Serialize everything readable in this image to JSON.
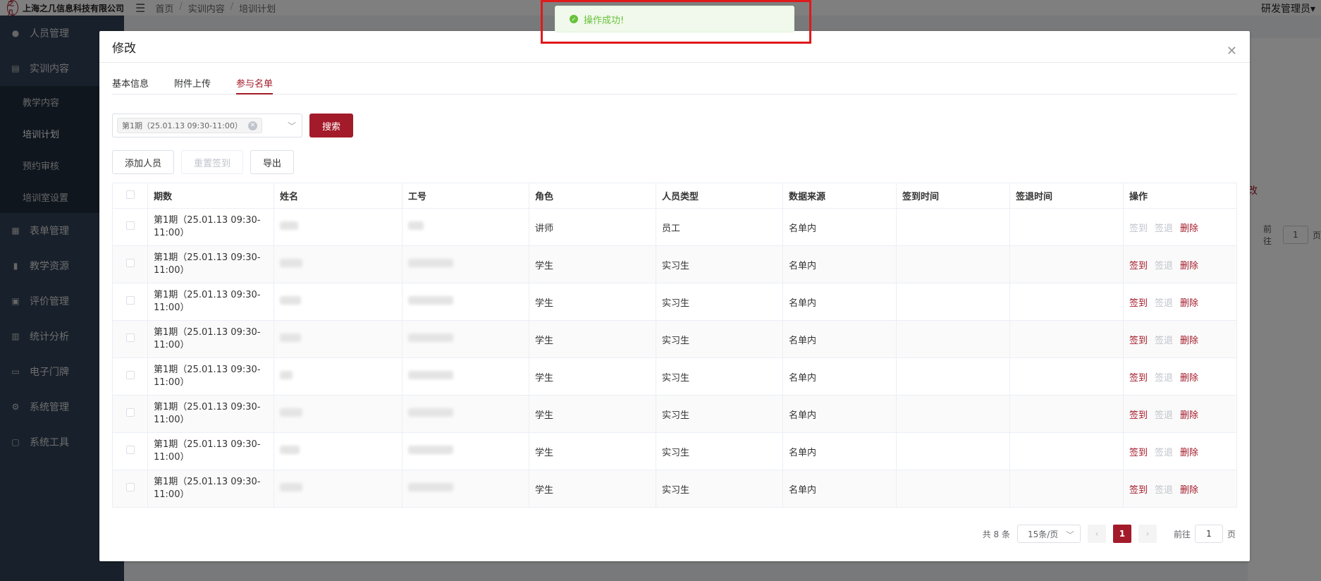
{
  "app": {
    "company": "上海之几信息科技有限公司",
    "logo_text": "之几",
    "user": "研发管理员",
    "breadcrumb": [
      "首页",
      "实训内容",
      "培训计划"
    ]
  },
  "sidebar": {
    "items": [
      {
        "label": "人员管理",
        "icon": "user-icon"
      },
      {
        "label": "实训内容",
        "icon": "doc-icon"
      },
      {
        "label": "表单管理",
        "icon": "form-icon"
      },
      {
        "label": "教学资源",
        "icon": "book-icon"
      },
      {
        "label": "评价管理",
        "icon": "rate-icon"
      },
      {
        "label": "统计分析",
        "icon": "chart-icon"
      },
      {
        "label": "电子门牌",
        "icon": "monitor-icon"
      },
      {
        "label": "系统管理",
        "icon": "gear-icon"
      },
      {
        "label": "系统工具",
        "icon": "tool-icon"
      }
    ],
    "sub_items": [
      "教学内容",
      "培训计划",
      "预约审核",
      "培训室设置"
    ]
  },
  "background": {
    "tab_fragment": "改",
    "goto_label": "前往",
    "goto_value": "1",
    "goto_suffix": "页"
  },
  "toast": {
    "message": "操作成功!"
  },
  "dialog": {
    "title": "修改",
    "tabs": [
      "基本信息",
      "附件上传",
      "参与名单"
    ],
    "active_tab": 2,
    "filter": {
      "selected_tag": "第1期（25.01.13 09:30-11:00）",
      "search_label": "搜索"
    },
    "actions": {
      "add": "添加人员",
      "reset_sign": "重置签到",
      "export": "导出"
    },
    "table": {
      "columns": [
        "期数",
        "姓名",
        "工号",
        "角色",
        "人员类型",
        "数据来源",
        "签到时间",
        "签退时间",
        "操作"
      ],
      "rows": [
        {
          "period": "第1期（25.01.13 09:30-11:00）",
          "role": "讲师",
          "type": "员工",
          "source": "名单内"
        },
        {
          "period": "第1期（25.01.13 09:30-11:00）",
          "role": "学生",
          "type": "实习生",
          "source": "名单内"
        },
        {
          "period": "第1期（25.01.13 09:30-11:00）",
          "role": "学生",
          "type": "实习生",
          "source": "名单内"
        },
        {
          "period": "第1期（25.01.13 09:30-11:00）",
          "role": "学生",
          "type": "实习生",
          "source": "名单内"
        },
        {
          "period": "第1期（25.01.13 09:30-11:00）",
          "role": "学生",
          "type": "实习生",
          "source": "名单内"
        },
        {
          "period": "第1期（25.01.13 09:30-11:00）",
          "role": "学生",
          "type": "实习生",
          "source": "名单内"
        },
        {
          "period": "第1期（25.01.13 09:30-11:00）",
          "role": "学生",
          "type": "实习生",
          "source": "名单内"
        },
        {
          "period": "第1期（25.01.13 09:30-11:00）",
          "role": "学生",
          "type": "实习生",
          "source": "名单内"
        }
      ],
      "ops": {
        "sign_in": "签到",
        "sign_out": "签退",
        "delete": "删除"
      }
    },
    "pagination": {
      "total": "共 8 条",
      "page_size": "15条/页",
      "current": "1",
      "goto_label": "前往",
      "goto_value": "1",
      "goto_suffix": "页"
    }
  },
  "colors": {
    "brand": "#a31b2a",
    "success": "#67c23a",
    "highlight_frame": "#e0191b"
  }
}
